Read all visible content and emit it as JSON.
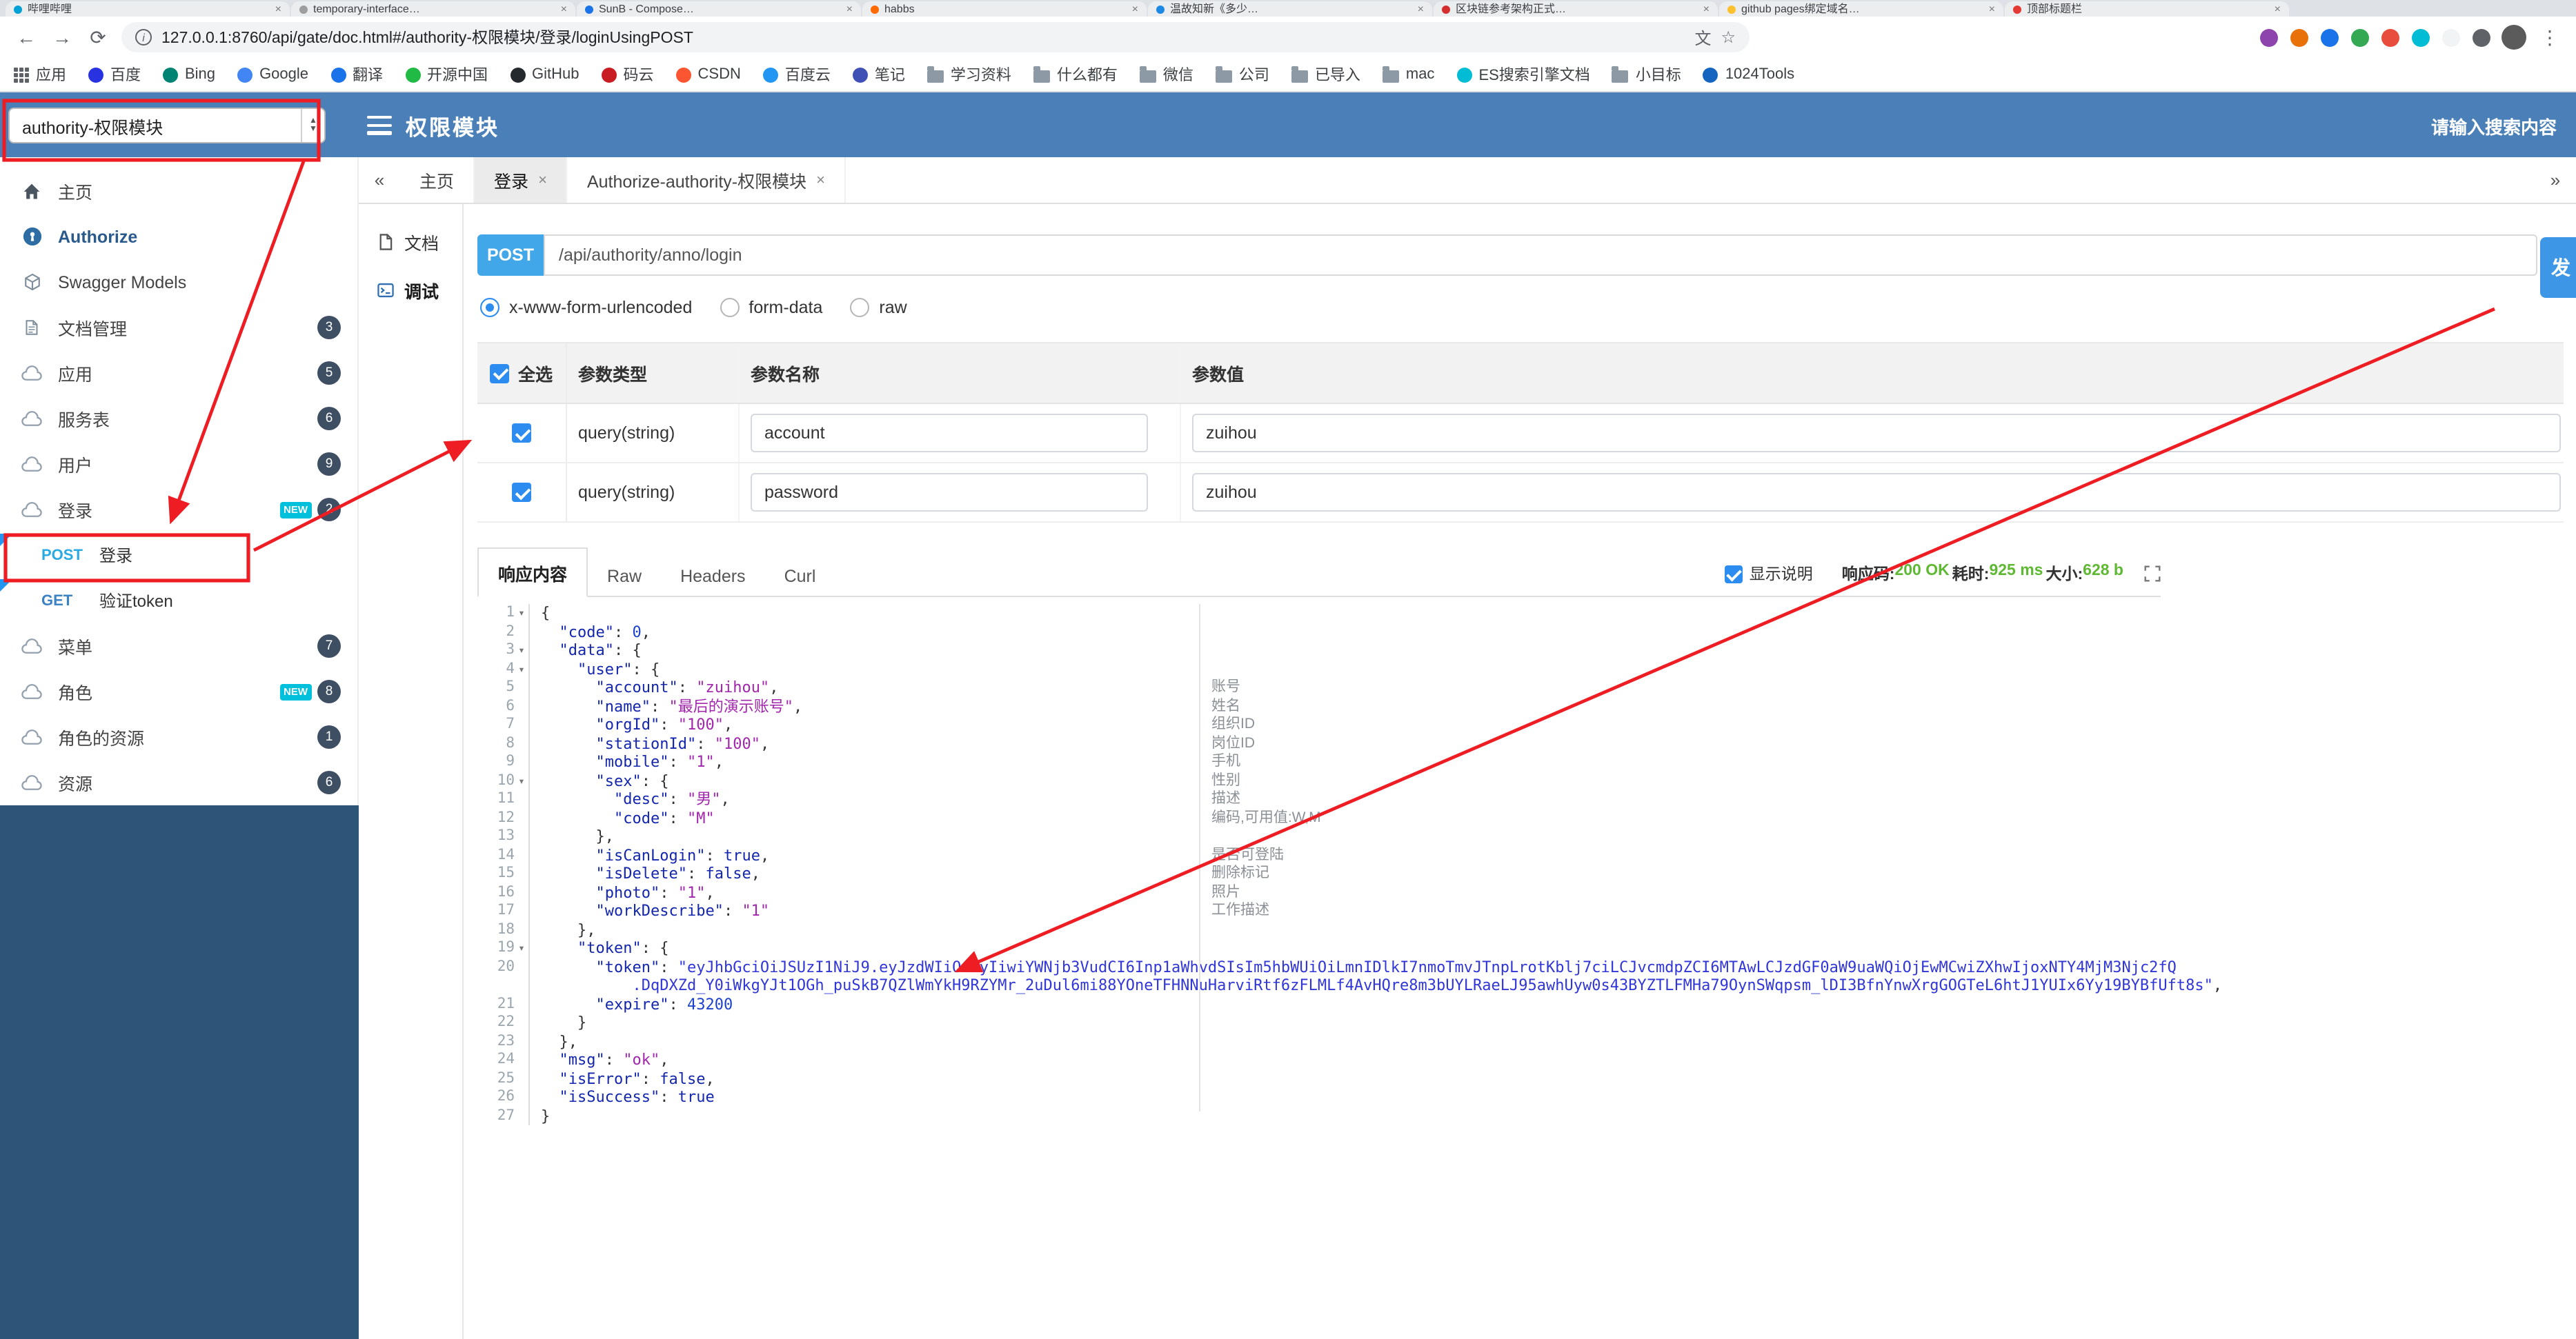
{
  "colors": {
    "header_blue": "#4a7fb7",
    "post_blue": "#41a7e8",
    "send_blue": "#3e97e6",
    "success_green": "#5fb832",
    "annotation_red": "#ee1d23",
    "sidebar_dark": "#2e5578"
  },
  "icons": {
    "back": "←",
    "forward": "→",
    "reload": "⟳",
    "info": "i",
    "translate": "文",
    "star": "☆",
    "more": "⋮",
    "close": "×",
    "left_chevrons": "«",
    "right_chevrons": "»",
    "fold": "▾",
    "spin_up": "▲",
    "spin_down": "▼"
  },
  "browser": {
    "tabs": [
      {
        "title": "哔哩哔哩",
        "color": "#00a1d6"
      },
      {
        "title": "temporary-interface…",
        "color": "#9e9e9e"
      },
      {
        "title": "SunB - Compose…",
        "color": "#1a73e8"
      },
      {
        "title": "habbs",
        "color": "#ff6a00"
      },
      {
        "title": "温故知新《多少…",
        "color": "#1e88e5"
      },
      {
        "title": "区块链参考架构正式…",
        "color": "#d32f2f"
      },
      {
        "title": "github pages绑定域名…",
        "color": "#fbc02d"
      },
      {
        "title": "顶部标题栏",
        "color": "#e53935"
      }
    ],
    "url": "127.0.0.1:8760/api/gate/doc.html#/authority-权限模块/登录/loginUsingPOST",
    "extensions": [
      "#8e44ad",
      "#e8710a",
      "#1a73e8",
      "#34a853",
      "#e74c3c",
      "#00bcd4",
      "#f1f3f4",
      "#5f6368"
    ],
    "bookmarks": [
      {
        "label": "应用",
        "icon": "apps"
      },
      {
        "label": "百度",
        "icon": "site",
        "color": "#2932e1"
      },
      {
        "label": "Bing",
        "icon": "site",
        "color": "#008373"
      },
      {
        "label": "Google",
        "icon": "site",
        "color": "#4285f4"
      },
      {
        "label": "翻译",
        "icon": "site",
        "color": "#1a73e8"
      },
      {
        "label": "开源中国",
        "icon": "site",
        "color": "#21ba45"
      },
      {
        "label": "GitHub",
        "icon": "site",
        "color": "#24292e"
      },
      {
        "label": "码云",
        "icon": "site",
        "color": "#c71d23"
      },
      {
        "label": "CSDN",
        "icon": "site",
        "color": "#fc5531"
      },
      {
        "label": "百度云",
        "icon": "site",
        "color": "#2196f3"
      },
      {
        "label": "笔记",
        "icon": "site",
        "color": "#3f51b5"
      },
      {
        "label": "学习资料",
        "icon": "folder"
      },
      {
        "label": "什么都有",
        "icon": "folder"
      },
      {
        "label": "微信",
        "icon": "folder"
      },
      {
        "label": "公司",
        "icon": "folder"
      },
      {
        "label": "已导入",
        "icon": "folder"
      },
      {
        "label": "mac",
        "icon": "folder"
      },
      {
        "label": "ES搜索引擎文档",
        "icon": "site",
        "color": "#00bcd4"
      },
      {
        "label": "小目标",
        "icon": "folder"
      },
      {
        "label": "1024Tools",
        "icon": "site",
        "color": "#1565c0"
      }
    ]
  },
  "header": {
    "group_select": "authority-权限模块",
    "title": "权限模块",
    "search_placeholder": "请输入搜索内容"
  },
  "sidebar": {
    "items": [
      {
        "label": "主页",
        "icon": "home"
      },
      {
        "label": "Authorize",
        "icon": "authorize",
        "accent": true
      },
      {
        "label": "Swagger Models",
        "icon": "models"
      },
      {
        "label": "文档管理",
        "icon": "docfile",
        "badge": "3"
      },
      {
        "label": "应用",
        "icon": "cloud",
        "badge": "5"
      },
      {
        "label": "服务表",
        "icon": "cloud",
        "badge": "6"
      },
      {
        "label": "用户",
        "icon": "cloud",
        "badge": "9"
      },
      {
        "label": "登录",
        "icon": "cloud",
        "badge": "2",
        "isnew": true
      },
      {
        "label": "登录",
        "method": "POST",
        "selected": true
      },
      {
        "label": "验证token",
        "method": "GET"
      },
      {
        "label": "菜单",
        "icon": "cloud",
        "badge": "7"
      },
      {
        "label": "角色",
        "icon": "cloud",
        "badge": "8",
        "isnew": true
      },
      {
        "label": "角色的资源",
        "icon": "cloud",
        "badge": "1"
      },
      {
        "label": "资源",
        "icon": "cloud",
        "badge": "6"
      }
    ]
  },
  "content": {
    "tab_bar": {
      "tabs": [
        {
          "label": "主页",
          "closable": false,
          "active": false
        },
        {
          "label": "登录",
          "closable": true,
          "active": true
        },
        {
          "label": "Authorize-authority-权限模块",
          "closable": true,
          "active": false
        }
      ]
    },
    "side_tabs": [
      {
        "label": "文档",
        "icon": "docmini",
        "active": false
      },
      {
        "label": "调试",
        "icon": "debug",
        "active": true
      }
    ],
    "request": {
      "method": "POST",
      "path": "/api/authority/anno/login",
      "send_label": "发",
      "body_types": [
        "x-www-form-urlencoded",
        "form-data",
        "raw"
      ],
      "selected_body_type": "x-www-form-urlencoded",
      "params": {
        "select_all": "全选",
        "headers": [
          "参数类型",
          "参数名称",
          "参数值"
        ],
        "rows": [
          {
            "checked": true,
            "type": "query(string)",
            "name": "account",
            "value": "zuihou"
          },
          {
            "checked": true,
            "type": "query(string)",
            "name": "password",
            "value": "zuihou"
          }
        ]
      }
    },
    "response": {
      "tabs": [
        {
          "label": "响应内容",
          "active": true
        },
        {
          "label": "Raw",
          "active": false
        },
        {
          "label": "Headers",
          "active": false
        },
        {
          "label": "Curl",
          "active": false
        }
      ],
      "show_desc": "显示说明",
      "show_desc_checked": true,
      "meta": [
        {
          "label": "响应码:",
          "value": "200 OK"
        },
        {
          "label": "耗时:",
          "value": "925 ms"
        },
        {
          "label": "大小:",
          "value": "628 b"
        }
      ],
      "code_lines": [
        {
          "fold": true,
          "t": [
            [
              "p",
              "{"
            ]
          ]
        },
        {
          "t": [
            [
              "p",
              "  "
            ],
            [
              "k",
              "\"code\""
            ],
            [
              "p",
              ": "
            ],
            [
              "n",
              "0"
            ],
            [
              "p",
              ","
            ]
          ]
        },
        {
          "fold": true,
          "t": [
            [
              "p",
              "  "
            ],
            [
              "k",
              "\"data\""
            ],
            [
              "p",
              ": {"
            ]
          ]
        },
        {
          "fold": true,
          "t": [
            [
              "p",
              "    "
            ],
            [
              "k",
              "\"user\""
            ],
            [
              "p",
              ": {"
            ]
          ]
        },
        {
          "t": [
            [
              "p",
              "      "
            ],
            [
              "k",
              "\"account\""
            ],
            [
              "p",
              ": "
            ],
            [
              "s",
              "\"zuihou\""
            ],
            [
              "p",
              ","
            ]
          ]
        },
        {
          "t": [
            [
              "p",
              "      "
            ],
            [
              "k",
              "\"name\""
            ],
            [
              "p",
              ": "
            ],
            [
              "s",
              "\"最后的演示账号\""
            ],
            [
              "p",
              ","
            ]
          ]
        },
        {
          "t": [
            [
              "p",
              "      "
            ],
            [
              "k",
              "\"orgId\""
            ],
            [
              "p",
              ": "
            ],
            [
              "s",
              "\"100\""
            ],
            [
              "p",
              ","
            ]
          ]
        },
        {
          "t": [
            [
              "p",
              "      "
            ],
            [
              "k",
              "\"stationId\""
            ],
            [
              "p",
              ": "
            ],
            [
              "s",
              "\"100\""
            ],
            [
              "p",
              ","
            ]
          ]
        },
        {
          "t": [
            [
              "p",
              "      "
            ],
            [
              "k",
              "\"mobile\""
            ],
            [
              "p",
              ": "
            ],
            [
              "s",
              "\"1\""
            ],
            [
              "p",
              ","
            ]
          ]
        },
        {
          "fold": true,
          "t": [
            [
              "p",
              "      "
            ],
            [
              "k",
              "\"sex\""
            ],
            [
              "p",
              ": {"
            ]
          ]
        },
        {
          "t": [
            [
              "p",
              "        "
            ],
            [
              "k",
              "\"desc\""
            ],
            [
              "p",
              ": "
            ],
            [
              "s",
              "\"男\""
            ],
            [
              "p",
              ","
            ]
          ]
        },
        {
          "t": [
            [
              "p",
              "        "
            ],
            [
              "k",
              "\"code\""
            ],
            [
              "p",
              ": "
            ],
            [
              "s",
              "\"M\""
            ]
          ]
        },
        {
          "t": [
            [
              "p",
              "      },"
            ]
          ]
        },
        {
          "t": [
            [
              "p",
              "      "
            ],
            [
              "k",
              "\"isCanLogin\""
            ],
            [
              "p",
              ": "
            ],
            [
              "b",
              "true"
            ],
            [
              "p",
              ","
            ]
          ]
        },
        {
          "t": [
            [
              "p",
              "      "
            ],
            [
              "k",
              "\"isDelete\""
            ],
            [
              "p",
              ": "
            ],
            [
              "b",
              "false"
            ],
            [
              "p",
              ","
            ]
          ]
        },
        {
          "t": [
            [
              "p",
              "      "
            ],
            [
              "k",
              "\"photo\""
            ],
            [
              "p",
              ": "
            ],
            [
              "s",
              "\"1\""
            ],
            [
              "p",
              ","
            ]
          ]
        },
        {
          "t": [
            [
              "p",
              "      "
            ],
            [
              "k",
              "\"workDescribe\""
            ],
            [
              "p",
              ": "
            ],
            [
              "s",
              "\"1\""
            ]
          ]
        },
        {
          "t": [
            [
              "p",
              "    },"
            ]
          ]
        },
        {
          "fold": true,
          "t": [
            [
              "p",
              "    "
            ],
            [
              "k",
              "\"token\""
            ],
            [
              "p",
              ": {"
            ]
          ]
        },
        {
          "t": [
            [
              "p",
              "      "
            ],
            [
              "k",
              "\"token\""
            ],
            [
              "p",
              ": "
            ],
            [
              "t",
              "\"eyJhbGciOiJSUzI1NiJ9.eyJzdWIiOiIyIiwiYWNjb3VudCI6Inp1aWhvdSIsIm5hbWUiOiLmnIDlkI7nmoTmvJTnpLrotKblj7ciLCJvcmdpZCI6MTAwLCJzdGF0aW9uaWQiOjEwMCwiZXhwIjoxNTY4MjM3Njc2fQ"
            ],
            [
              "br",
              "          "
            ],
            [
              "t",
              ".DqDXZd_Y0iWkgYJt1OGh_puSkB7QZlWmYkH9RZYMr_2uDul6mi88YOneTFHNNuHarviRtf6zFLMLf4AvHQre8m3bUYLRaeLJ95awhUyw0s43BYZTLFMHa79OynSWqpsm_lDI3BfnYnwXrgGOGTeL6htJ1YUIx6Yy19BYBfUft8s\""
            ],
            [
              "p",
              ","
            ]
          ]
        },
        {
          "t": [
            [
              "p",
              "      "
            ],
            [
              "k",
              "\"expire\""
            ],
            [
              "p",
              ": "
            ],
            [
              "n",
              "43200"
            ]
          ]
        },
        {
          "t": [
            [
              "p",
              "    }"
            ]
          ]
        },
        {
          "t": [
            [
              "p",
              "  },"
            ]
          ]
        },
        {
          "t": [
            [
              "p",
              "  "
            ],
            [
              "k",
              "\"msg\""
            ],
            [
              "p",
              ": "
            ],
            [
              "s",
              "\"ok\""
            ],
            [
              "p",
              ","
            ]
          ]
        },
        {
          "t": [
            [
              "p",
              "  "
            ],
            [
              "k",
              "\"isError\""
            ],
            [
              "p",
              ": "
            ],
            [
              "b",
              "false"
            ],
            [
              "p",
              ","
            ]
          ]
        },
        {
          "t": [
            [
              "p",
              "  "
            ],
            [
              "k",
              "\"isSuccess\""
            ],
            [
              "p",
              ": "
            ],
            [
              "b",
              "true"
            ]
          ]
        },
        {
          "t": [
            [
              "p",
              "}"
            ]
          ]
        }
      ],
      "field_notes": [
        {
          "line": 5,
          "text": "账号"
        },
        {
          "line": 6,
          "text": "姓名"
        },
        {
          "line": 7,
          "text": "组织ID"
        },
        {
          "line": 8,
          "text": "岗位ID"
        },
        {
          "line": 9,
          "text": "手机"
        },
        {
          "line": 10,
          "text": "性别"
        },
        {
          "line": 11,
          "text": "描述"
        },
        {
          "line": 12,
          "text": "编码,可用值:W,M"
        },
        {
          "line": 14,
          "text": "是否可登陆"
        },
        {
          "line": 15,
          "text": "删除标记"
        },
        {
          "line": 16,
          "text": "照片"
        },
        {
          "line": 17,
          "text": "工作描述"
        }
      ]
    }
  }
}
